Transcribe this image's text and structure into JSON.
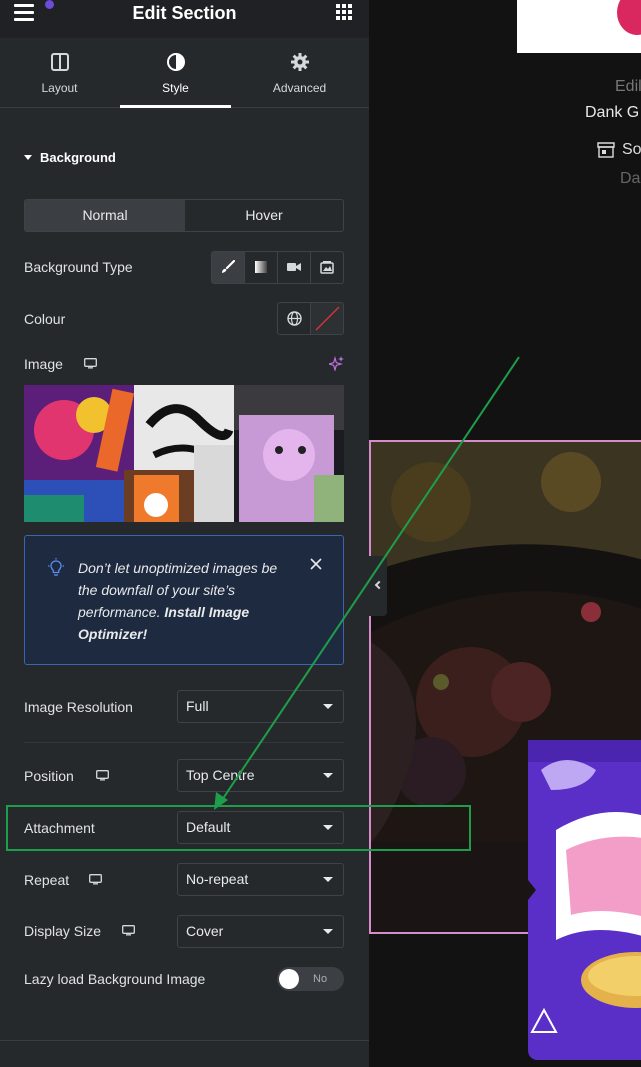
{
  "header": {
    "title": "Edit Section"
  },
  "tabs": [
    {
      "label": "Layout"
    },
    {
      "label": "Style"
    },
    {
      "label": "Advanced"
    }
  ],
  "section": {
    "title": "Background"
  },
  "state_toggle": {
    "normal": "Normal",
    "hover": "Hover"
  },
  "background_type": {
    "label": "Background Type"
  },
  "colour": {
    "label": "Colour"
  },
  "image": {
    "label": "Image"
  },
  "notice": {
    "text_before": "Don’t let unoptimized images be the downfall of your site’s performance. ",
    "link": "Install Image Optimizer!"
  },
  "fields": {
    "image_resolution": {
      "label": "Image Resolution",
      "value": "Full"
    },
    "position": {
      "label": "Position",
      "value": "Top Centre"
    },
    "attachment": {
      "label": "Attachment",
      "value": "Default"
    },
    "repeat": {
      "label": "Repeat",
      "value": "No-repeat"
    },
    "display_size": {
      "label": "Display Size",
      "value": "Cover"
    }
  },
  "lazy_load": {
    "label": "Lazy load Background Image",
    "state": "No"
  },
  "preview": {
    "small_text": "Edil",
    "product_name": "Dank G",
    "store_text": "So",
    "sub_text": "Da"
  },
  "colors": {
    "panel_bg": "#26292c",
    "topbar_bg": "#1f2124",
    "notice_border": "#3b63b8",
    "annotation_green": "#1e9e4a",
    "selection_pink": "#d68cc8"
  }
}
